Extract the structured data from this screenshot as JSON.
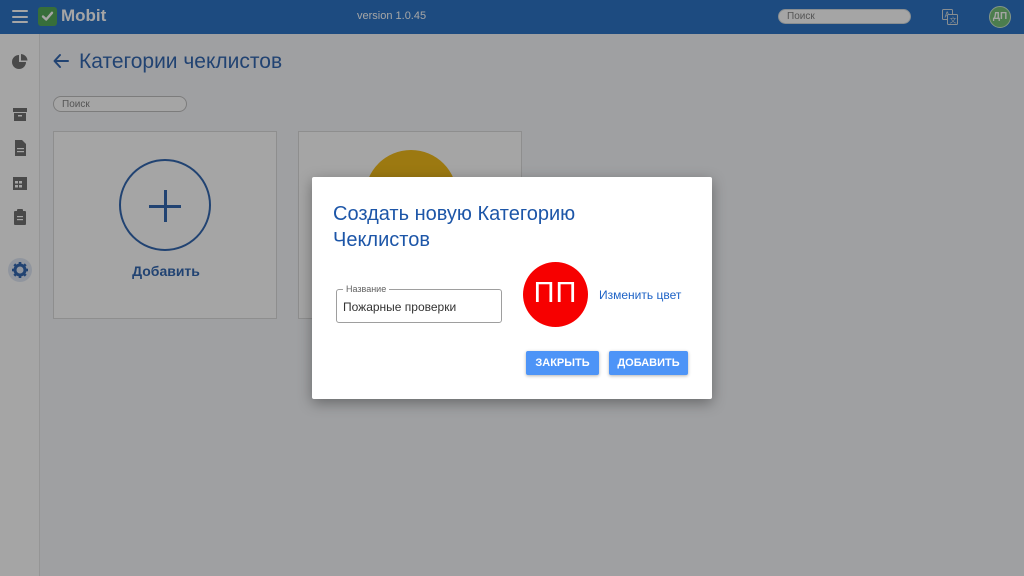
{
  "header": {
    "app_name": "Mobit",
    "version": "version 1.0.45",
    "search_placeholder": "Поиск",
    "avatar_initials": "ДП"
  },
  "sidebar": {
    "icons": [
      "pie-chart-icon",
      "archive-box-icon",
      "document-icon",
      "calendar-icon",
      "clipboard-icon",
      "gear-icon"
    ],
    "active": "gear-icon"
  },
  "page": {
    "title": "Категории чеклистов",
    "search_placeholder": "Поиск",
    "add_card_label": "Добавить"
  },
  "dialog": {
    "title": "Создать новую Категорию Чеклистов",
    "field_label": "Название",
    "field_value": "Пожарные проверки",
    "preview_initials": "ПП",
    "preview_color": "#f70000",
    "change_color_label": "Изменить цвет",
    "close_button": "ЗАКРЫТЬ",
    "add_button": "ДОБАВИТЬ"
  },
  "colors": {
    "topbar": "#1565c0",
    "accent": "#1d56a8",
    "button": "#4d94f7",
    "category_circle": "#f0b400"
  }
}
